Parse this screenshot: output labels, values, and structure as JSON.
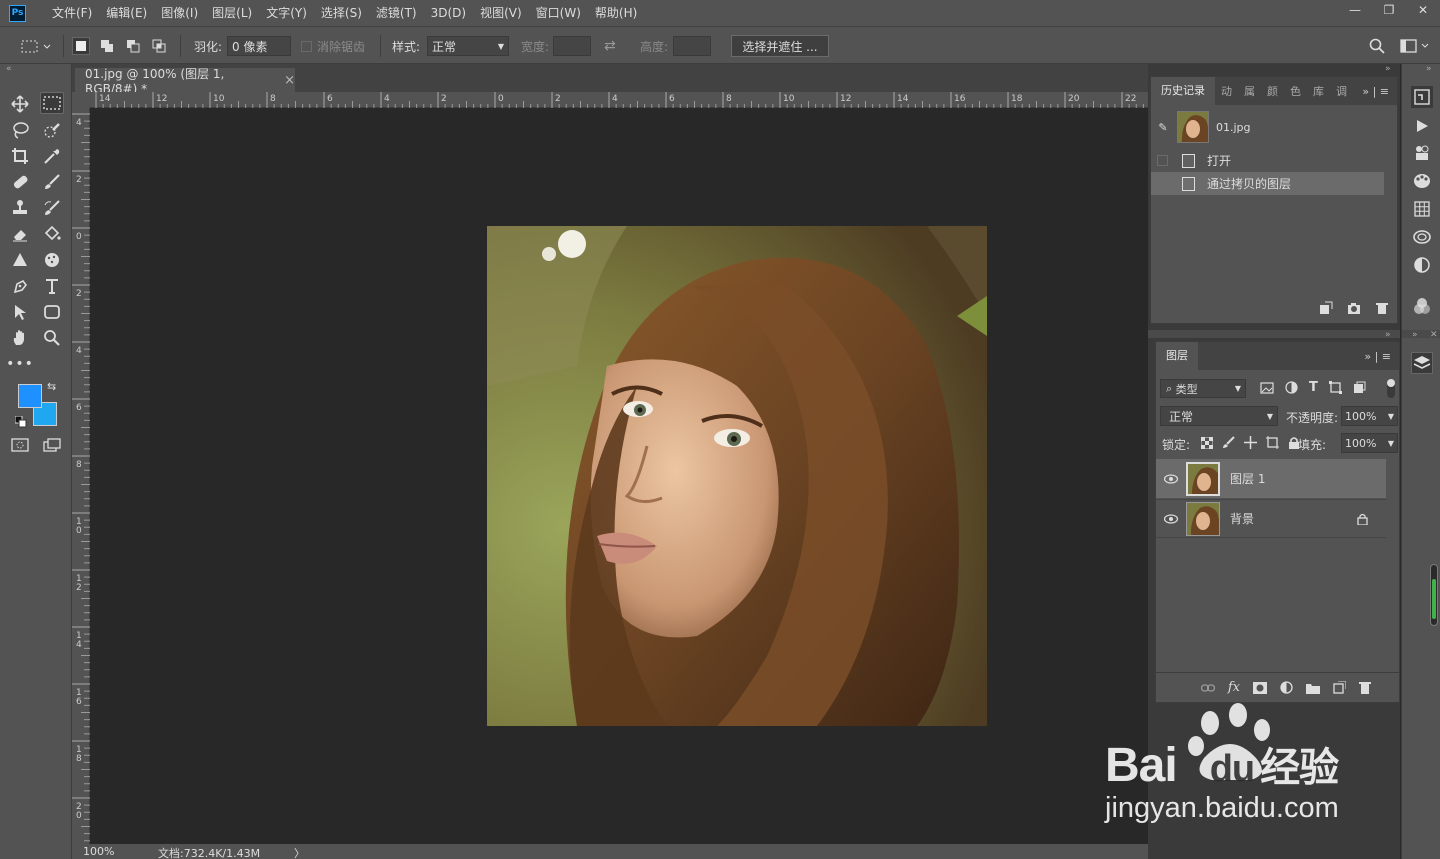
{
  "app": {
    "logo": "Ps"
  },
  "menus": [
    "文件(F)",
    "编辑(E)",
    "图像(I)",
    "图层(L)",
    "文字(Y)",
    "选择(S)",
    "滤镜(T)",
    "3D(D)",
    "视图(V)",
    "窗口(W)",
    "帮助(H)"
  ],
  "window_controls": [
    "—",
    "❐",
    "✕"
  ],
  "options": {
    "feather_label": "羽化:",
    "feather_value": "0 像素",
    "antialias_label": "消除锯齿",
    "style_label": "样式:",
    "style_value": "正常",
    "width_label": "宽度:",
    "height_label": "高度:",
    "select_mask_button": "选择并遮住 ..."
  },
  "document": {
    "tab_title": "01.jpg @ 100% (图层 1, RGB/8#) *",
    "close": "×"
  },
  "ruler_top": [
    "14",
    "12",
    "10",
    "8",
    "6",
    "4",
    "2",
    "0",
    "2",
    "4",
    "6",
    "8",
    "10",
    "12",
    "14",
    "16",
    "18",
    "20",
    "22"
  ],
  "ruler_left": [
    "4",
    "2",
    "0",
    "2",
    "4",
    "6",
    "8",
    "10",
    "12",
    "14",
    "16",
    "18",
    "20"
  ],
  "status": {
    "zoom": "100%",
    "doc_info": "文档:732.4K/1.43M",
    "arrow": "〉"
  },
  "history": {
    "tab_active": "历史记录",
    "tabs_other": [
      "动",
      "属",
      "颜",
      "色",
      "库",
      "调"
    ],
    "snapshot_name": "01.jpg",
    "steps": [
      "打开",
      "通过拷贝的图层"
    ]
  },
  "layers_panel": {
    "tab": "图层",
    "filter_label": "类型",
    "blend_mode": "正常",
    "opacity_label": "不透明度:",
    "opacity_value": "100%",
    "lock_label": "锁定:",
    "fill_label": "填充:",
    "fill_value": "100%",
    "layers": [
      {
        "name": "图层 1",
        "selected": true
      },
      {
        "name": "背景",
        "locked": true
      }
    ]
  },
  "colors": {
    "foreground": "#1e90ff",
    "background": "#1fa8f0",
    "selection": "#6b6b6b"
  },
  "watermark": {
    "brand": "Bai",
    "brand2": "du",
    "cn": "经验",
    "url": "jingyan.baidu.com"
  }
}
